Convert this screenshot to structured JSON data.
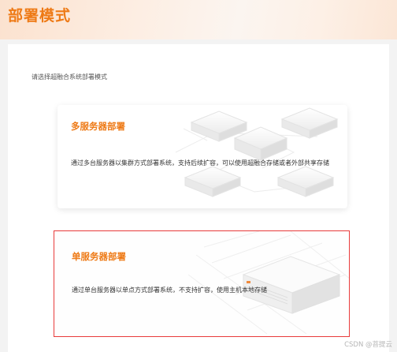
{
  "page": {
    "title": "部署模式",
    "instruction": "请选择超融合系统部署模式"
  },
  "cards": [
    {
      "title": "多服务器部署",
      "description": "通过多台服务器以集群方式部署系统，支持后续扩容，可以使用超融合存储或者外部共享存储",
      "selected": false
    },
    {
      "title": "单服务器部署",
      "description": "通过单台服务器以单点方式部署系统，不支持扩容，使用主机本地存储",
      "selected": true
    }
  ],
  "watermark": "CSDN @菩提云",
  "colors": {
    "accent": "#ee7a16",
    "selected_border": "#e83b3b"
  }
}
